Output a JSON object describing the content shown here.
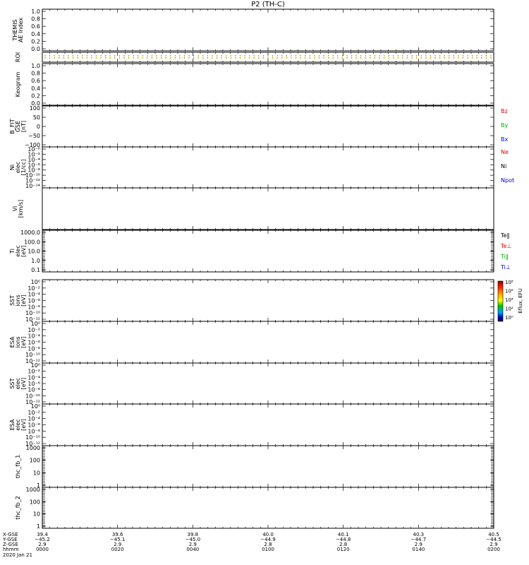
{
  "title": "P2  (TH-C)",
  "date_label": "2020 Jan 21",
  "colorbar": {
    "label": "Eflux, EFU",
    "ticks": [
      "10⁸",
      "10⁶",
      "10⁴",
      "10²",
      "10⁰"
    ]
  },
  "chart_data": [
    {
      "type": "line",
      "name": "ae",
      "ylabel_lines": [
        "THEMIS",
        "AE Index"
      ],
      "ylim": [
        0,
        1
      ],
      "ticks": [
        "1.0",
        "0.8",
        "0.6",
        "0.4",
        "0.2",
        "0.0"
      ],
      "series": []
    },
    {
      "type": "scatter",
      "name": "roi",
      "ylabel_lines": [
        "ROI"
      ],
      "marker_color": "#c8a000",
      "series": []
    },
    {
      "type": "line",
      "name": "keogram",
      "ylabel_lines": [
        "Keogram"
      ],
      "ylim": [
        0,
        1
      ],
      "ticks": [
        "1.0",
        "0.8",
        "0.6",
        "0.4",
        "0.2",
        "0.0"
      ],
      "series": []
    },
    {
      "type": "line",
      "name": "bfit",
      "ylabel_lines": [
        "B_FIT",
        "GSE",
        "[nT]"
      ],
      "ylim": [
        -100,
        100
      ],
      "ticks": [
        "100",
        "50",
        "0",
        "−50",
        "−100"
      ],
      "series": [
        {
          "name": "Bz",
          "color": "#e00000",
          "values": []
        },
        {
          "name": "By",
          "color": "#00b000",
          "values": []
        },
        {
          "name": "Bx",
          "color": "#0000d0",
          "values": []
        }
      ]
    },
    {
      "type": "line",
      "name": "ni",
      "ylabel_lines": [
        "Ni",
        "elec",
        "[1/cc]"
      ],
      "ylim": [
        1e-14,
        1.0
      ],
      "scale": "log",
      "ticks": [
        "10⁻⁰",
        "10⁻²",
        "10⁻⁴",
        "10⁻⁶",
        "10⁻⁸",
        "10⁻¹⁰",
        "10⁻¹²",
        "10⁻¹⁴"
      ],
      "series": [
        {
          "name": "Ne",
          "color": "#e00000",
          "values": []
        },
        {
          "name": "Ni",
          "color": "#000000",
          "values": []
        },
        {
          "name": "Npot",
          "color": "#0000d0",
          "values": []
        }
      ]
    },
    {
      "type": "line",
      "name": "vi",
      "ylabel_lines": [
        "Vi",
        "[km/s]"
      ],
      "series": []
    },
    {
      "type": "line",
      "name": "ti",
      "ylabel_lines": [
        "Ti",
        "elec",
        "[eV]"
      ],
      "scale": "log",
      "ticks": [
        "1000.0",
        "100.0",
        "10.0",
        "1.0",
        "0.1"
      ],
      "series": [
        {
          "name": "Te‖",
          "color": "#000000",
          "values": []
        },
        {
          "name": "Te⊥",
          "color": "#e00000",
          "values": []
        },
        {
          "name": "Ti‖",
          "color": "#00b000",
          "values": []
        },
        {
          "name": "Ti⊥",
          "color": "#0000d0",
          "values": []
        }
      ]
    },
    {
      "type": "heatmap",
      "name": "sst_ion",
      "ylabel_lines": [
        "SST",
        "ions",
        "[eV]"
      ],
      "scale": "log",
      "ticks": [
        "10⁰",
        "10⁻²",
        "10⁻⁴",
        "10⁻⁶",
        "10⁻⁸",
        "10⁻¹⁰",
        "10⁻¹²"
      ],
      "series": []
    },
    {
      "type": "heatmap",
      "name": "esa_ion",
      "ylabel_lines": [
        "ESA",
        "ions",
        "[eV]"
      ],
      "scale": "log",
      "ticks": [
        "10⁰",
        "10⁻²",
        "10⁻⁴",
        "10⁻⁶",
        "10⁻⁸",
        "10⁻¹⁰",
        "10⁻¹²"
      ],
      "series": []
    },
    {
      "type": "heatmap",
      "name": "sst_elec",
      "ylabel_lines": [
        "SST",
        "elec",
        "[eV]"
      ],
      "scale": "log",
      "ticks": [
        "10⁰",
        "10⁻²",
        "10⁻⁴",
        "10⁻⁶",
        "10⁻⁸",
        "10⁻¹⁰",
        "10⁻¹²"
      ],
      "series": []
    },
    {
      "type": "heatmap",
      "name": "esa_elec",
      "ylabel_lines": [
        "ESA",
        "elec",
        "[eV]"
      ],
      "scale": "log",
      "ticks": [
        "10⁰",
        "10⁻²",
        "10⁻⁴",
        "10⁻⁶",
        "10⁻⁸",
        "10⁻¹⁰",
        "10⁻¹²"
      ],
      "series": []
    },
    {
      "type": "line",
      "name": "fb1",
      "ylabel_lines": [
        "thc_fb_1"
      ],
      "scale": "log",
      "ticks": [
        "1000",
        "100",
        "10",
        "1"
      ],
      "series": []
    },
    {
      "type": "line",
      "name": "fb2",
      "ylabel_lines": [
        "thc_fb_2"
      ],
      "scale": "log",
      "ticks": [
        "1000",
        "100",
        "10",
        "1"
      ],
      "series": []
    }
  ],
  "x_axis": {
    "row_labels": [
      "X-GSE",
      "Y-GSE",
      "Z-GSE",
      "hhmm"
    ],
    "ticks": [
      {
        "x": "39.4",
        "y": "−45.2",
        "z": "2.9",
        "t": "0000"
      },
      {
        "x": "39.6",
        "y": "−45.1",
        "z": "2.9",
        "t": "0020"
      },
      {
        "x": "39.8",
        "y": "−45.0",
        "z": "2.9",
        "t": "0040"
      },
      {
        "x": "40.0",
        "y": "−44.9",
        "z": "2.8",
        "t": "0100"
      },
      {
        "x": "40.1",
        "y": "−44.8",
        "z": "2.8",
        "t": "0120"
      },
      {
        "x": "40.3",
        "y": "−44.7",
        "z": "2.9",
        "t": "0140"
      },
      {
        "x": "40.5",
        "y": "−44.5",
        "z": "2.9",
        "t": "0200"
      }
    ]
  }
}
